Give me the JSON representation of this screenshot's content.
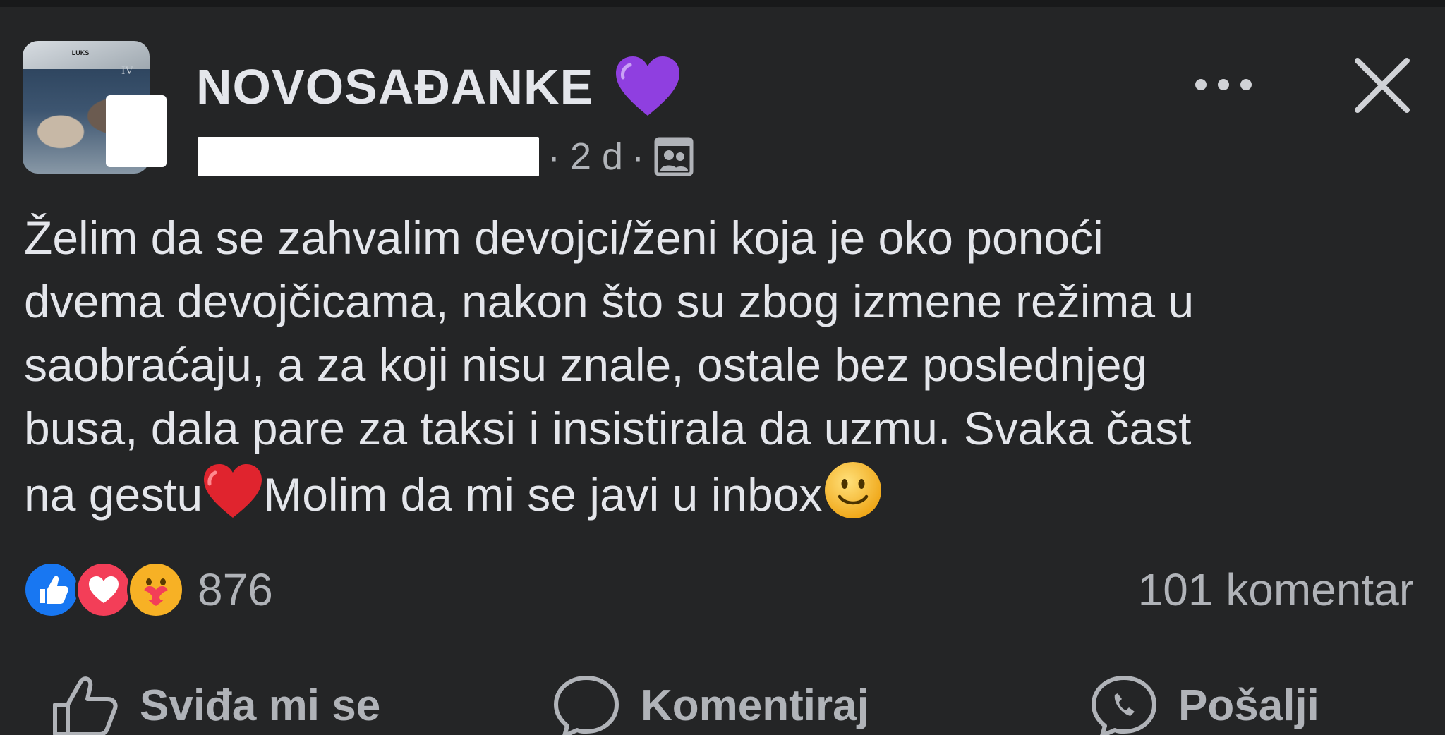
{
  "post": {
    "group_name": "NOVOSAĐANKE",
    "group_name_emoji": "purple-heart-icon",
    "avatar_title": "LUKS",
    "avatar_badge": "IV",
    "meta": {
      "separator": "·",
      "time": "2 d",
      "audience_icon": "group-members-icon"
    },
    "text_lines": [
      "Želim da se zahvalim devojci/ženi koja je oko ponoći",
      "dvema devojčicama, nakon što su zbog izmene režima u",
      "saobraćaju, a za koji nisu znale, ostale bez poslednjeg",
      "busa, dala pare za taksi i insistirala da uzmu. Svaka čast"
    ],
    "last_line": {
      "part1": "na gestu",
      "emoji1": "red-heart-icon",
      "part2": "Molim da mi se javi u inbox",
      "emoji2": "smiling-face-icon"
    },
    "reactions": {
      "types": [
        "like-reaction-icon",
        "love-reaction-icon",
        "care-reaction-icon"
      ],
      "count": "876"
    },
    "comments": "101 komentar",
    "actions": {
      "like": "Sviđa mi se",
      "comment": "Komentiraj",
      "send": "Pošalji"
    }
  },
  "colors": {
    "background": "#242526",
    "text": "#e4e6eb",
    "secondary_text": "#b0b3b8",
    "like_blue": "#1877f2",
    "love_red": "#f33e58",
    "care_yellow": "#f7b125",
    "heart_purple": "#8f3fe0"
  }
}
